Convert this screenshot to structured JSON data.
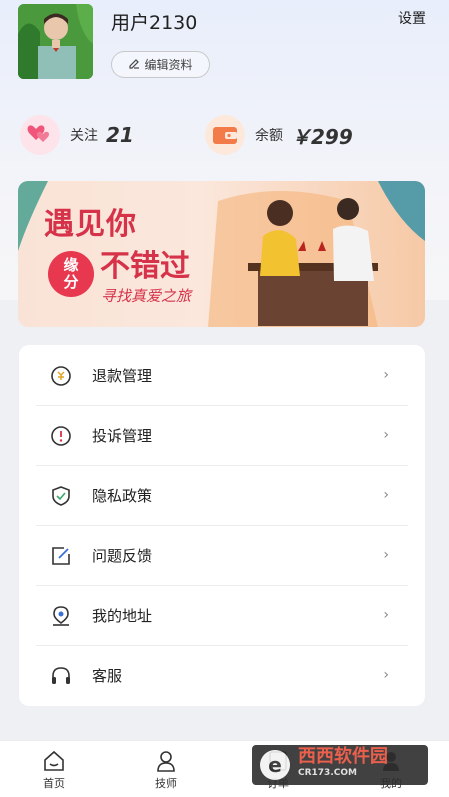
{
  "header": {
    "username": "用户2130",
    "edit_label": "编辑资料",
    "settings_label": "设置"
  },
  "stats": {
    "follow_label": "关注",
    "follow_value": "21",
    "balance_label": "余额",
    "balance_value": "￥299"
  },
  "banner": {
    "title_line1": "遇见你",
    "title_line2": "不错过",
    "badge_line1": "缘",
    "badge_line2": "分",
    "subtitle": "寻找真爱之旅"
  },
  "menu": {
    "items": [
      {
        "label": "退款管理",
        "icon": "refund-icon"
      },
      {
        "label": "投诉管理",
        "icon": "complaint-icon"
      },
      {
        "label": "隐私政策",
        "icon": "shield-icon"
      },
      {
        "label": "问题反馈",
        "icon": "feedback-icon"
      },
      {
        "label": "我的地址",
        "icon": "address-icon"
      },
      {
        "label": "客服",
        "icon": "headset-icon"
      }
    ],
    "arrow": "›"
  },
  "tabbar": {
    "home": "首页",
    "technician": "技师",
    "orders": "订单",
    "mine": "我的"
  },
  "watermark": {
    "text": "西西软件园",
    "sub": "CR173.COM"
  },
  "colors": {
    "accent_red": "#d6334a",
    "follow_icon": "#f0567a",
    "balance_icon": "#f37b4a"
  }
}
